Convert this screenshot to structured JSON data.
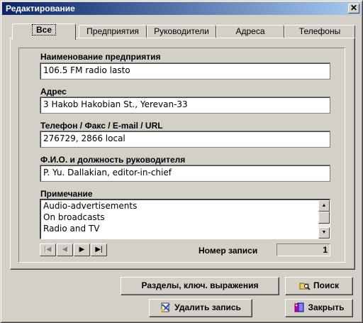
{
  "window": {
    "title": "Редактирование",
    "close_glyph": "✕"
  },
  "tabs": [
    {
      "label": "Все",
      "active": true
    },
    {
      "label": "Предприятия",
      "active": false
    },
    {
      "label": "Руководители",
      "active": false
    },
    {
      "label": "Адреса",
      "active": false
    },
    {
      "label": "Телефоны",
      "active": false
    }
  ],
  "fields": {
    "name": {
      "label": "Наименование предприятия",
      "value": "106.5 FM radio lasto"
    },
    "address": {
      "label": "Адрес",
      "value": "3 Hakob Hakobian St., Yerevan-33"
    },
    "phone": {
      "label": "Телефон / Факс / E-mail / URL",
      "value": "276729, 2866 local"
    },
    "director": {
      "label": "Ф.И.О. и должность руководителя",
      "value": "P. Yu. Dallakian, editor-in-chief"
    }
  },
  "note": {
    "label": "Примечание",
    "lines": [
      "Audio-advertisements",
      "On broadcasts",
      "Radio and TV"
    ]
  },
  "navigator": {
    "first_glyph": "|◀",
    "prev_glyph": "◀",
    "next_glyph": "▶",
    "last_glyph": "▶|"
  },
  "record": {
    "label": "Номер записи",
    "value": "1"
  },
  "buttons": {
    "sections": "Разделы, ключ. выражения",
    "search": "Поиск",
    "delete": "Удалить запись",
    "close": "Закрыть"
  },
  "icons": {
    "search": "search-folder-icon",
    "delete": "delete-record-icon",
    "close": "exit-door-icon"
  }
}
